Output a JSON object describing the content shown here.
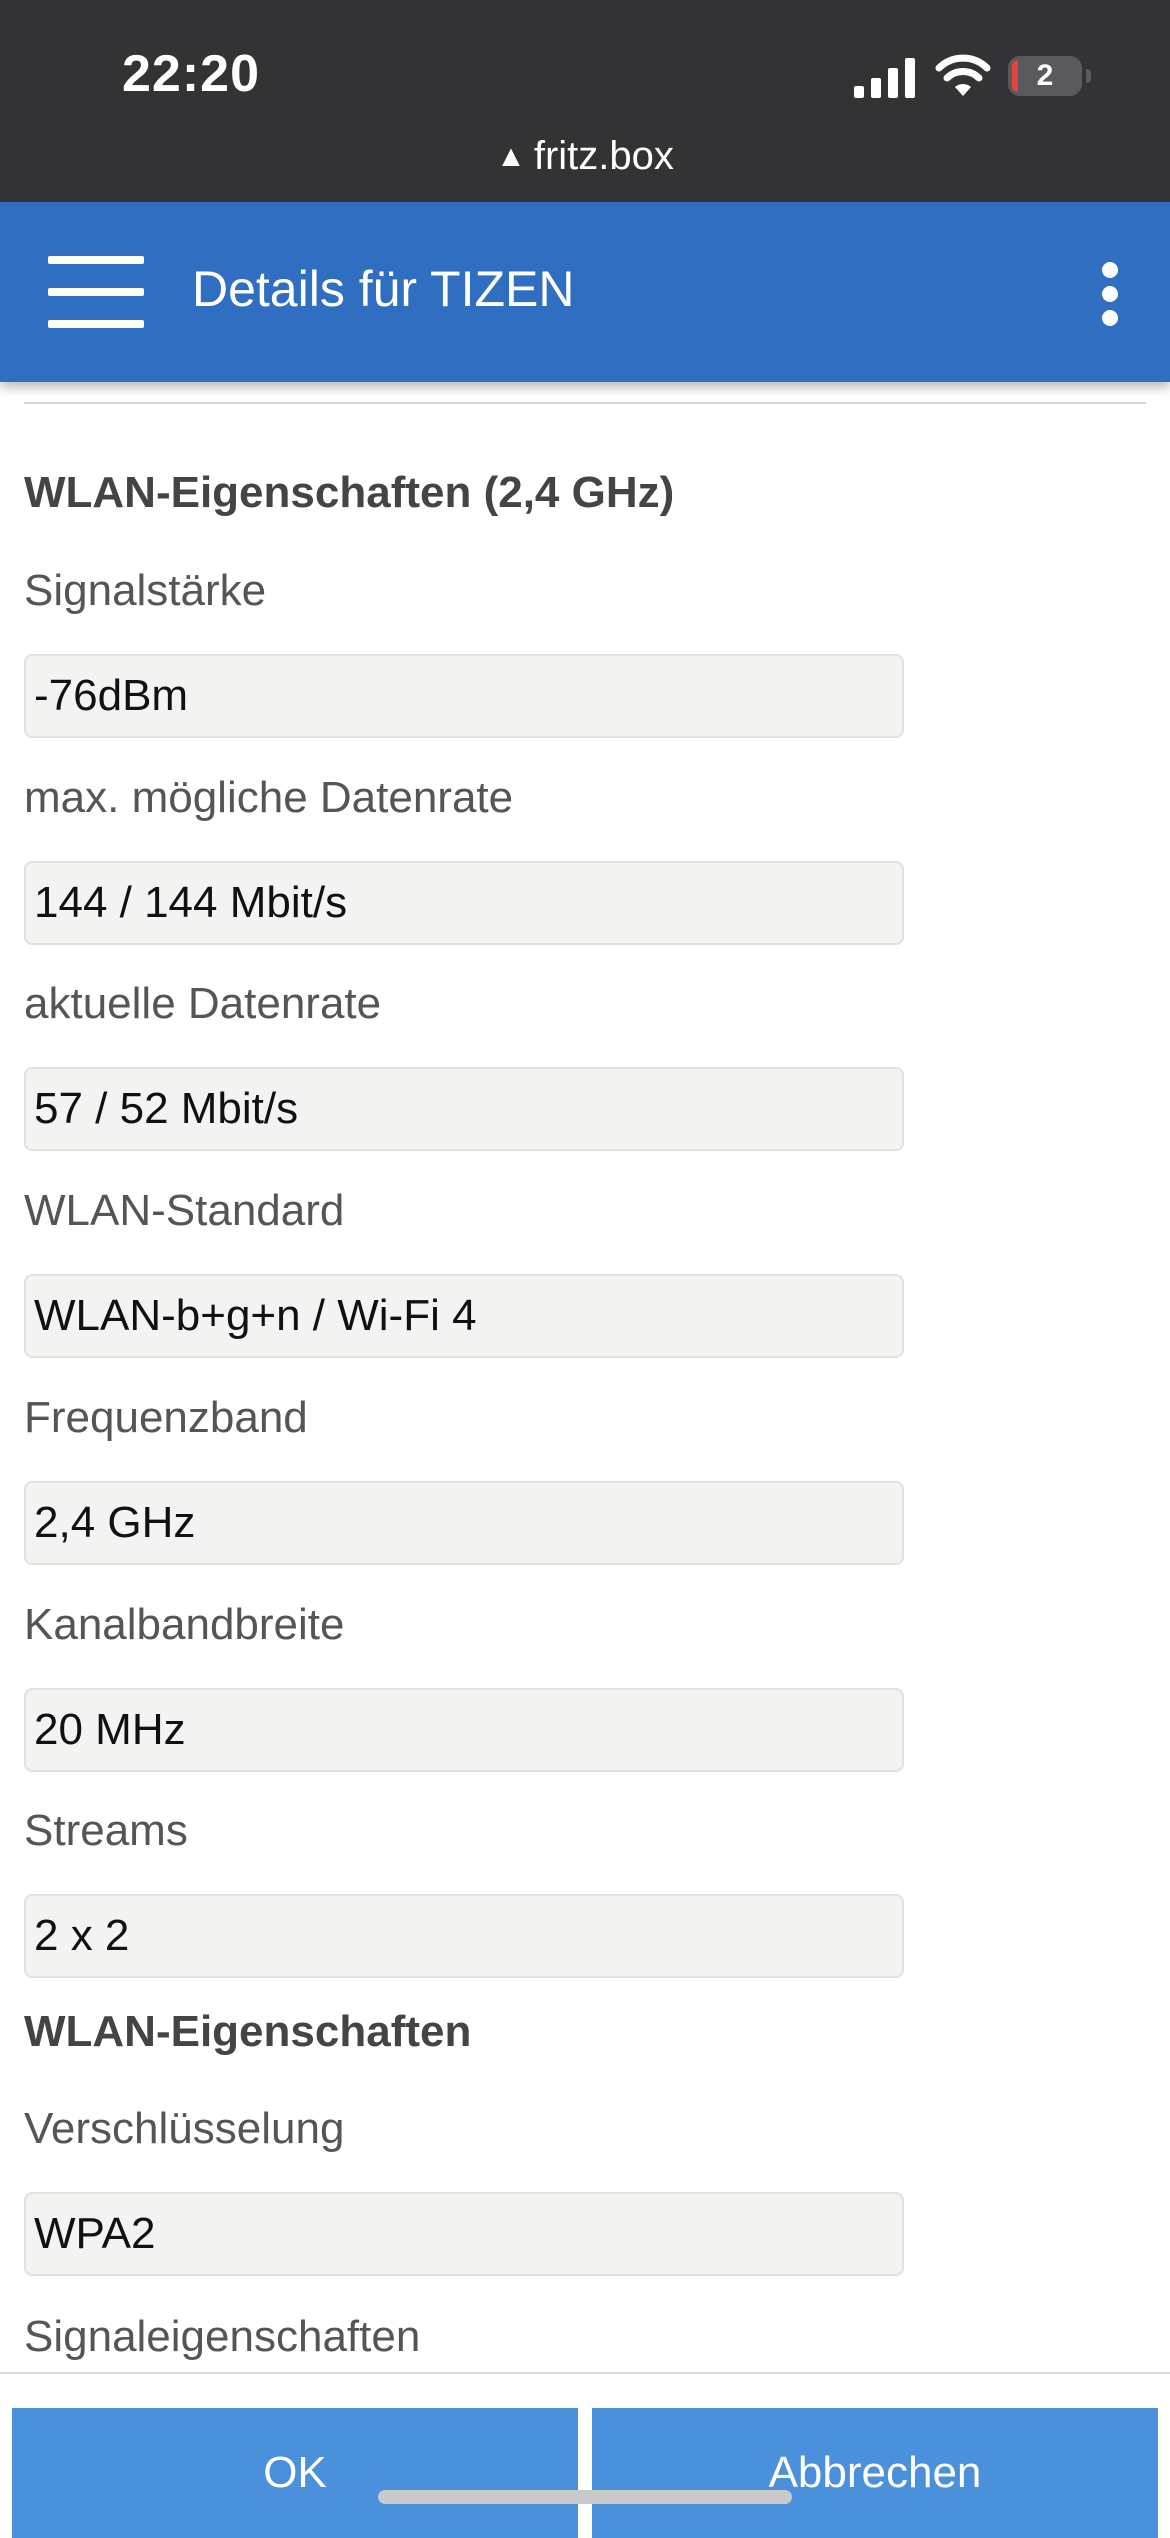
{
  "status_bar": {
    "time": "22:20",
    "battery_level": "2",
    "url": "fritz.box",
    "url_warning_icon": "warning-triangle-icon"
  },
  "header": {
    "title": "Details für TIZEN",
    "menu_icon": "hamburger-icon",
    "more_icon": "more-vertical-icon",
    "background_color": "#2f6ec0"
  },
  "sections": {
    "wlan_24": {
      "title": "WLAN-Eigenschaften (2,4 GHz)",
      "fields": [
        {
          "label": "Signalstärke",
          "value": "-76dBm"
        },
        {
          "label": "max. mögliche Datenrate",
          "value": "144 / 144 Mbit/s"
        },
        {
          "label": "aktuelle Datenrate",
          "value": "57 / 52 Mbit/s"
        },
        {
          "label": "WLAN-Standard",
          "value": "WLAN-b+g+n / Wi-Fi 4"
        },
        {
          "label": "Frequenzband",
          "value": "2,4 GHz"
        },
        {
          "label": "Kanalbandbreite",
          "value": "20 MHz"
        },
        {
          "label": "Streams",
          "value": "2 x 2"
        }
      ]
    },
    "wlan": {
      "title": "WLAN-Eigenschaften",
      "fields": [
        {
          "label": "Verschlüsselung",
          "value": "WPA2"
        },
        {
          "label": "Signaleigenschaften",
          "value": ""
        }
      ]
    }
  },
  "footer": {
    "ok_label": "OK",
    "cancel_label": "Abbrechen",
    "button_color": "#4a90da"
  }
}
